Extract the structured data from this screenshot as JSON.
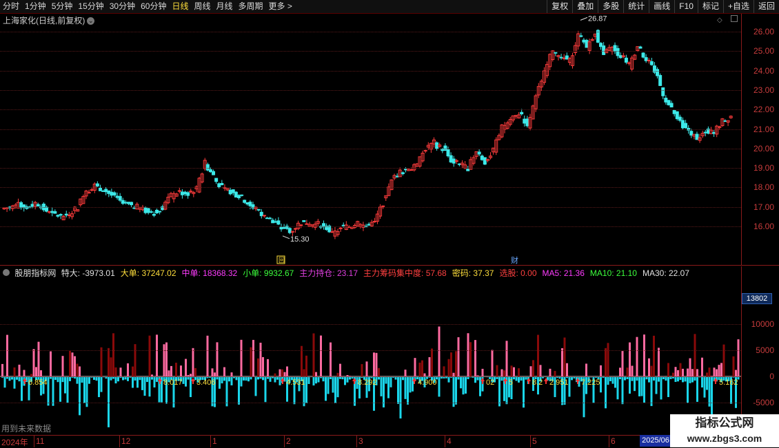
{
  "toolbar": {
    "periods": [
      "分时",
      "1分钟",
      "5分钟",
      "15分钟",
      "30分钟",
      "60分钟",
      "日线",
      "周线",
      "月线",
      "多周期",
      "更多 >"
    ],
    "active_period": "日线",
    "right_buttons": [
      "复权",
      "叠加",
      "多股",
      "统计",
      "画线",
      "F10",
      "标记",
      "+自选",
      "返回"
    ]
  },
  "chart_title": "上海家化(日线,前复权)",
  "price_axis": [
    "26.00",
    "25.00",
    "24.00",
    "23.00",
    "22.00",
    "21.00",
    "20.00",
    "19.00",
    "18.00",
    "17.00",
    "16.00"
  ],
  "annotations": {
    "high": "26.87",
    "low": "15.30",
    "cai_badge": "财",
    "hui_badge": "回"
  },
  "indicator": {
    "name": "股朋指标网",
    "items": [
      {
        "label": "特大",
        "value": "-3973.01",
        "color": "#e0e0e0"
      },
      {
        "label": "大单",
        "value": "37247.02",
        "color": "#ffdf3c"
      },
      {
        "label": "中单",
        "value": "18368.32",
        "color": "#ff3cff"
      },
      {
        "label": "小单",
        "value": "9932.67",
        "color": "#3cff3c"
      },
      {
        "label": "主力持仓",
        "value": "23.17",
        "color": "#e040e0"
      },
      {
        "label": "主力筹码集中度",
        "value": "57.68",
        "color": "#ff4040"
      },
      {
        "label": "密码",
        "value": "37.37",
        "color": "#ffdf3c"
      },
      {
        "label": "选股",
        "value": "0.00",
        "color": "#ff4040"
      },
      {
        "label": "MA5",
        "value": "21.36",
        "color": "#ff3cff"
      },
      {
        "label": "MA10",
        "value": "21.10",
        "color": "#3cff3c"
      },
      {
        "label": "MA30",
        "value": "22.07",
        "color": "#e0e0e0"
      }
    ],
    "axis": [
      "10000",
      "5000",
      "0",
      "-5000"
    ],
    "current_value": "13802"
  },
  "signal_labels": [
    "6.854",
    "8.017",
    "3.406",
    "4.531",
    "8.292",
    "4.900",
    "02",
    "5",
    "8.2",
    "2.951",
    "7.225",
    "5.162"
  ],
  "date_axis": [
    "2024年",
    "11",
    "12",
    "1",
    "2",
    "3",
    "4",
    "5",
    "6"
  ],
  "date_stamp": "2025/06",
  "future_note": "用到未来数据",
  "watermark": {
    "line1": "指标公式网",
    "line2": "www.zbgs3.com"
  },
  "chart_data": {
    "type": "candlestick",
    "y_range": [
      15.3,
      26.87
    ],
    "series": [
      {
        "name": "price",
        "values": [
          17.0,
          17.1,
          17.0,
          17.2,
          16.9,
          16.6,
          16.5,
          16.7,
          17.0,
          17.9,
          18.1,
          17.9,
          17.6,
          17.3,
          17.1,
          17.0,
          16.8,
          16.7,
          17.0,
          17.6,
          17.8,
          17.7,
          17.9,
          19.3,
          18.6,
          18.0,
          17.8,
          17.6,
          17.2,
          16.9,
          16.5,
          16.2,
          15.9,
          15.8,
          16.1,
          16.2,
          16.1,
          16.0,
          15.6,
          15.9,
          16.0,
          16.2,
          16.0,
          16.2,
          17.2,
          18.3,
          18.8,
          19.0,
          19.1,
          20.0,
          20.3,
          20.0,
          19.4,
          19.2,
          19.0,
          19.9,
          19.3,
          19.9,
          21.1,
          21.5,
          21.8,
          21.2,
          22.6,
          24.0,
          25.1,
          24.6,
          24.5,
          25.8,
          25.2,
          26.0,
          24.8,
          25.2,
          24.7,
          24.3,
          25.3,
          24.6,
          24.0,
          22.8,
          22.0,
          21.3,
          20.9,
          20.6,
          20.8,
          20.9,
          21.4,
          21.7
        ]
      }
    ],
    "volume_ylim": [
      -7500,
      13802
    ]
  }
}
